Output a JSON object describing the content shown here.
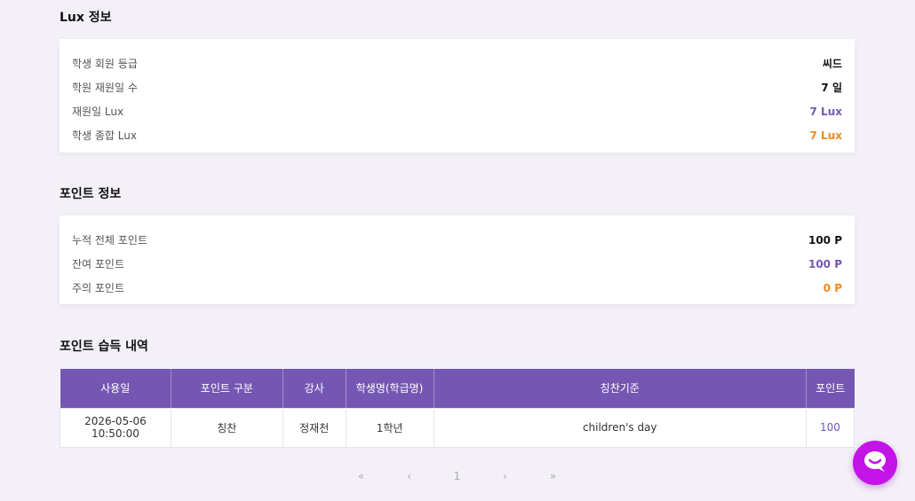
{
  "lux": {
    "title": "Lux 정보",
    "rows": [
      {
        "label": "학생 회원 등급",
        "value": "씨드"
      },
      {
        "label": "학원 재원일 수",
        "value": "7 일"
      },
      {
        "label": "재원일 Lux",
        "value": "7 Lux"
      },
      {
        "label": "학생 종합 Lux",
        "value": "7 Lux"
      }
    ]
  },
  "points": {
    "title": "포인트 정보",
    "rows": [
      {
        "label": "누적 전체 포인트",
        "value": "100 P"
      },
      {
        "label": "잔여 포인트",
        "value": "100 P"
      },
      {
        "label": "주의 포인트",
        "value": "0 P"
      }
    ]
  },
  "history": {
    "title": "포인트 습득 내역",
    "headers": [
      "사용일",
      "포인트 구분",
      "강사",
      "학생명(학급명)",
      "칭찬기준",
      "포인트"
    ],
    "rows": [
      [
        "2026-05-06 10:50:00",
        "칭찬",
        "정재천",
        "1학년",
        "children's day",
        "100"
      ]
    ]
  },
  "pagination": {
    "first": "«",
    "prev": "‹",
    "page": "1",
    "next": "›",
    "last": "»"
  },
  "colors": {
    "accent": "#7457b3",
    "orange": "#f08a1c",
    "chat": "#c413e6"
  },
  "chat_icon": "chat-bubble-icon"
}
